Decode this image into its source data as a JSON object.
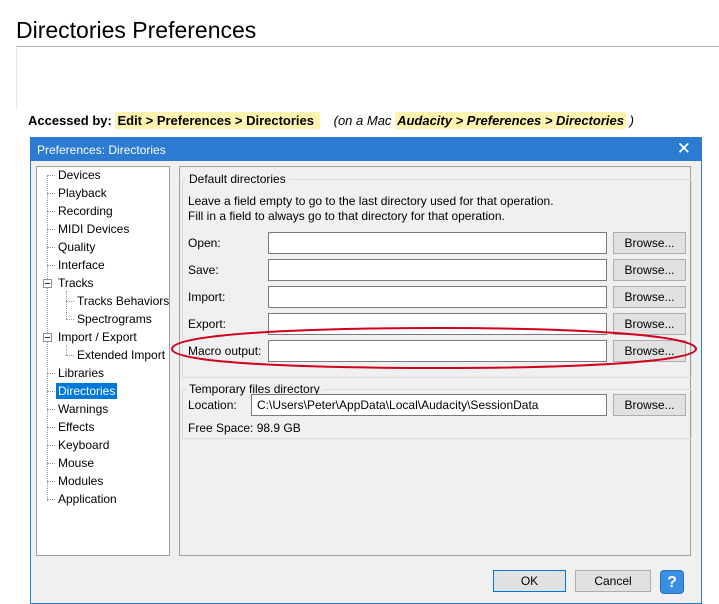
{
  "page": {
    "title": "Directories Preferences",
    "accessed_label": "Accessed by:",
    "accessed_path": "Edit > Preferences > Directories",
    "mac_prefix": "(on a Mac",
    "mac_path": "Audacity > Preferences > Directories",
    "mac_suffix": ")"
  },
  "dialog": {
    "title": "Preferences: Directories",
    "close_glyph": "✕",
    "tree": [
      {
        "label": "Devices"
      },
      {
        "label": "Playback"
      },
      {
        "label": "Recording"
      },
      {
        "label": "MIDI Devices"
      },
      {
        "label": "Quality"
      },
      {
        "label": "Interface"
      },
      {
        "label": "Tracks"
      },
      {
        "label": "Tracks Behaviors"
      },
      {
        "label": "Spectrograms"
      },
      {
        "label": "Import / Export"
      },
      {
        "label": "Extended Import"
      },
      {
        "label": "Libraries"
      },
      {
        "label": "Directories"
      },
      {
        "label": "Warnings"
      },
      {
        "label": "Effects"
      },
      {
        "label": "Keyboard"
      },
      {
        "label": "Mouse"
      },
      {
        "label": "Modules"
      },
      {
        "label": "Application"
      }
    ],
    "default_dirs": {
      "title": "Default directories",
      "help1": "Leave a field empty to go to the last directory used for that operation.",
      "help2": "Fill in a field to always go to that directory for that operation.",
      "rows": [
        {
          "label": "Open:",
          "value": ""
        },
        {
          "label": "Save:",
          "value": ""
        },
        {
          "label": "Import:",
          "value": ""
        },
        {
          "label": "Export:",
          "value": ""
        },
        {
          "label": "Macro output:",
          "value": ""
        }
      ],
      "browse_label": "Browse..."
    },
    "temp_dir": {
      "title": "Temporary files directory",
      "location_label": "Location:",
      "location_value": "C:\\Users\\Peter\\AppData\\Local\\Audacity\\SessionData",
      "browse_label": "Browse...",
      "free_space": "Free Space:  98.9 GB"
    },
    "buttons": {
      "ok": "OK",
      "cancel": "Cancel",
      "help": "?"
    }
  },
  "colors": {
    "title_bar": "#2b7bd0",
    "selection": "#0078d7",
    "highlight": "#fff3b0",
    "annotation": "#d0021b"
  }
}
